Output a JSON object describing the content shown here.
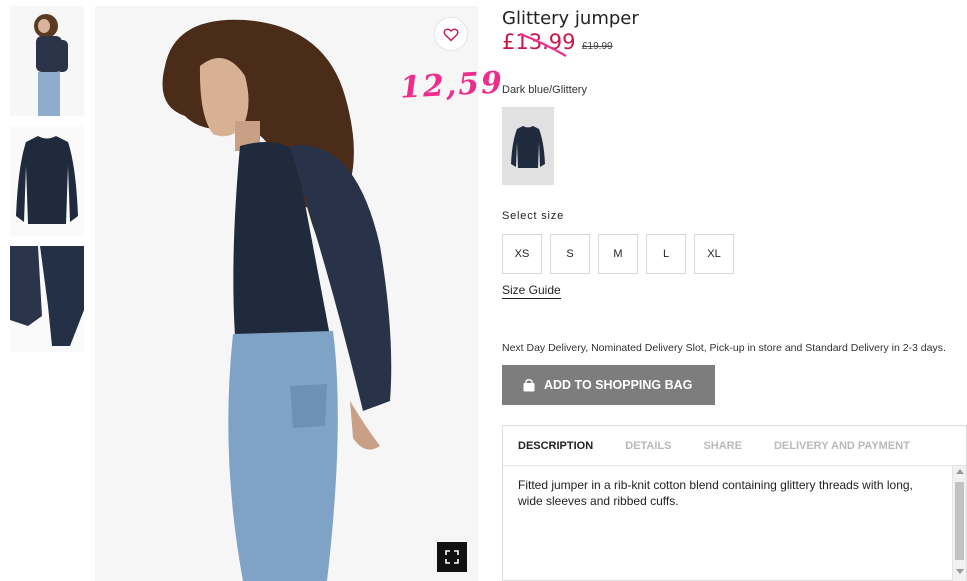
{
  "product": {
    "title": "Glittery jumper",
    "sale_price": "£13.99",
    "original_price": "£19.99",
    "color_label": "Dark blue/Glittery"
  },
  "annotation": "12,59",
  "size_section": {
    "heading": "Select size",
    "sizes": [
      "XS",
      "S",
      "M",
      "L",
      "XL"
    ],
    "guide_label": "Size Guide"
  },
  "delivery_text": "Next Day Delivery, Nominated Delivery Slot, Pick-up in store and Standard Delivery in 2-3 days.",
  "add_to_bag_label": "ADD TO SHOPPING BAG",
  "tabs": [
    {
      "label": "DESCRIPTION",
      "active": true
    },
    {
      "label": "DETAILS",
      "active": false
    },
    {
      "label": "SHARE",
      "active": false
    },
    {
      "label": "DELIVERY AND PAYMENT",
      "active": false
    }
  ],
  "description": "Fitted jumper in a rib-knit cotton blend containing glittery threads with long, wide sleeves and ribbed cuffs.",
  "colors": {
    "sale_price": "#c8174a",
    "annotation": "#ee2c8c",
    "button_bg": "#7d7d7d",
    "jumper": "#1f2a3d",
    "jeans": "#7fa3c7"
  },
  "icons": [
    "heart-icon",
    "expand-icon",
    "shopping-bag-icon"
  ]
}
